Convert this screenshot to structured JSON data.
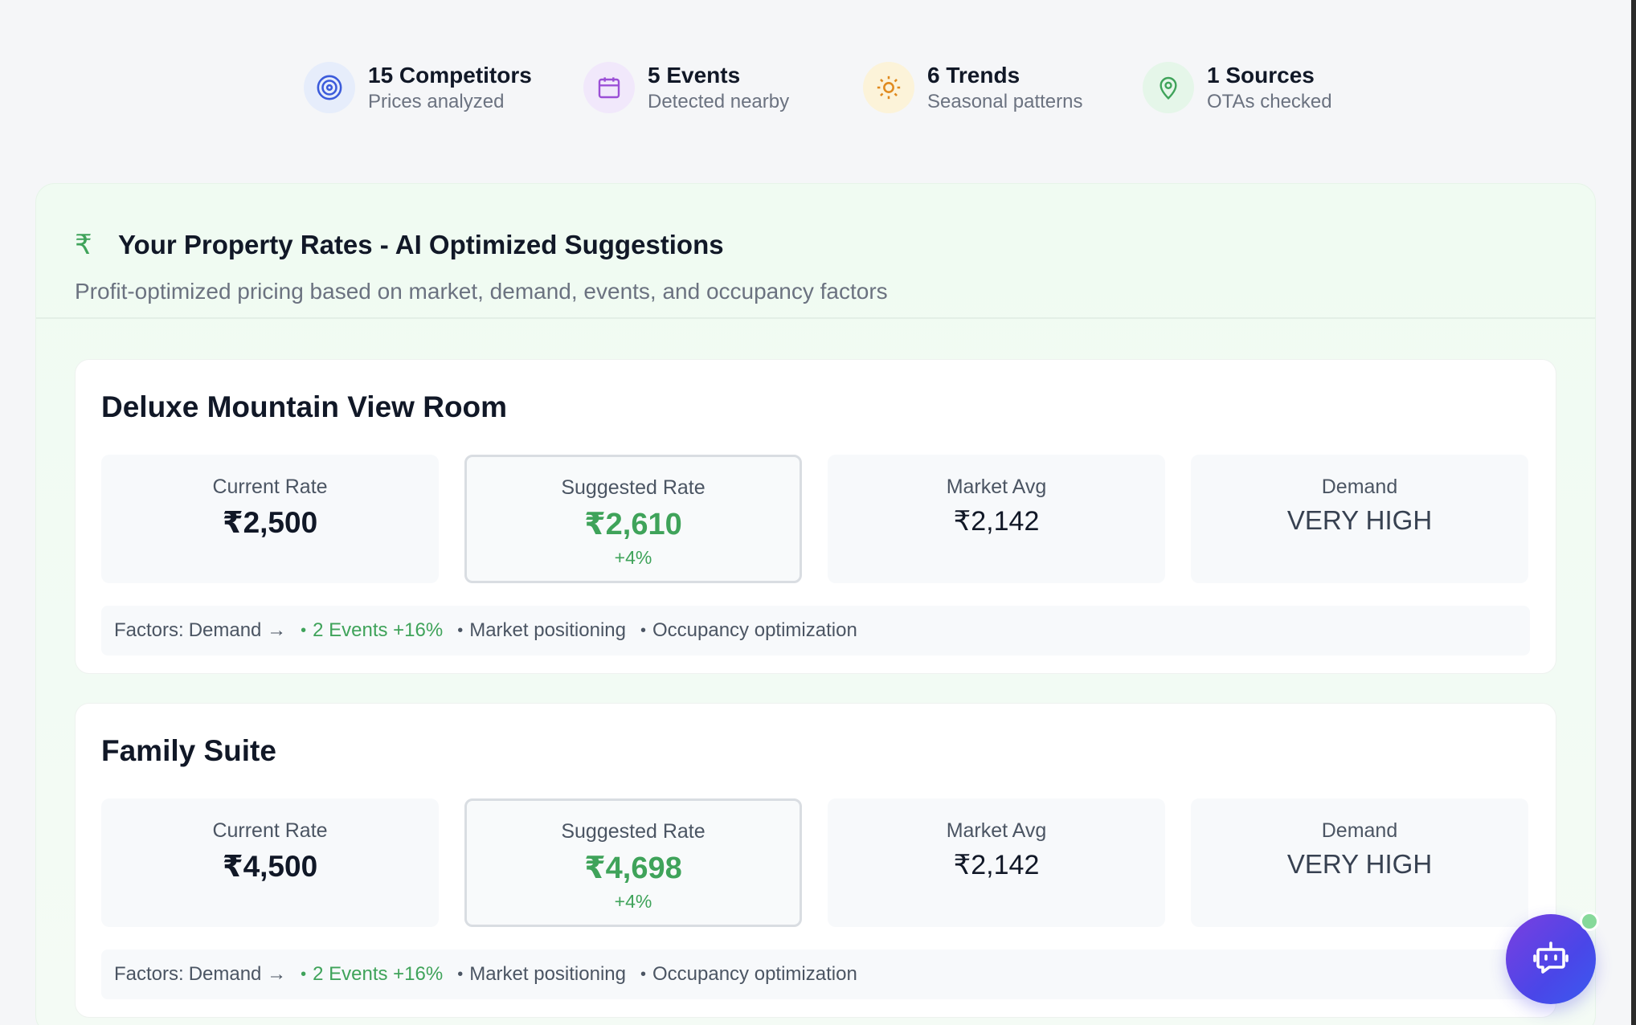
{
  "stats": [
    {
      "value": "15 Competitors",
      "label": "Prices analyzed",
      "icon": "target-icon"
    },
    {
      "value": "5 Events",
      "label": "Detected nearby",
      "icon": "calendar-icon"
    },
    {
      "value": "6 Trends",
      "label": "Seasonal patterns",
      "icon": "sun-icon"
    },
    {
      "value": "1 Sources",
      "label": "OTAs checked",
      "icon": "map-pin-icon"
    }
  ],
  "section": {
    "icon": "₹",
    "title": "Your Property Rates - AI Optimized Suggestions",
    "subtitle": "Profit-optimized pricing based on market, demand, events, and occupancy factors"
  },
  "labels": {
    "current_rate": "Current Rate",
    "suggested_rate": "Suggested Rate",
    "market_avg": "Market Avg",
    "demand": "Demand",
    "factors": "Factors:",
    "factor_demand": "Demand →"
  },
  "rooms": [
    {
      "name": "Deluxe Mountain View Room",
      "current_rate": "₹2,500",
      "suggested_rate": "₹2,610",
      "change": "+4%",
      "market_avg": "₹2,142",
      "demand": "VERY HIGH",
      "factors": [
        "2 Events +16%",
        "Market positioning",
        "Occupancy optimization"
      ]
    },
    {
      "name": "Family Suite",
      "current_rate": "₹4,500",
      "suggested_rate": "₹4,698",
      "change": "+4%",
      "market_avg": "₹2,142",
      "demand": "VERY HIGH",
      "factors": [
        "2 Events +16%",
        "Market positioning",
        "Occupancy optimization"
      ]
    }
  ],
  "colors": {
    "accent_green": "#3fa35a",
    "fab_gradient_start": "#7b3fe0",
    "fab_gradient_end": "#3a5bf0"
  }
}
